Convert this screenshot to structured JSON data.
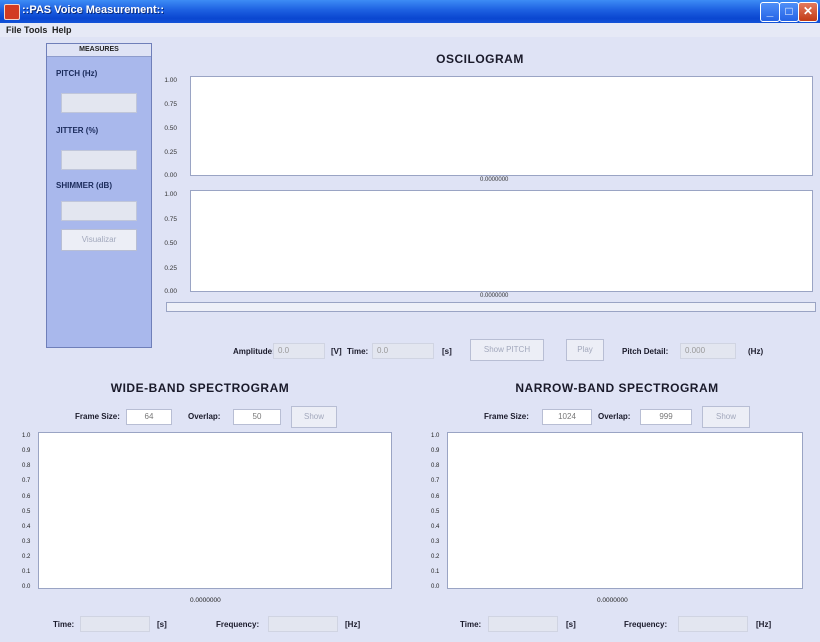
{
  "window": {
    "title": "::PAS Voice Measurement::"
  },
  "menu": [
    "File",
    "Tools",
    "Help"
  ],
  "measures": {
    "header": "MEASURES",
    "pitch_label": "PITCH (Hz)",
    "jitter_label": "JITTER (%)",
    "shimmer_label": "SHIMMER (dB)",
    "visualize_button": "Visualizar"
  },
  "oscilogram": {
    "title": "OSCILOGRAM",
    "top_ticks": [
      "1.00",
      "0.75",
      "0.50",
      "0.25",
      "0.00"
    ],
    "bottom_ticks": [
      "1.00",
      "0.75",
      "0.50",
      "0.25",
      "0.00"
    ],
    "top_x_label": "0.0000000",
    "bottom_x_label": "0.0000000",
    "amplitude_label": "Amplitude:",
    "amplitude_value": "0.0",
    "amplitude_unit": "[V]",
    "time_label": "Time:",
    "time_value": "0.0",
    "time_unit": "[s]",
    "show_pitch_button": "Show PITCH",
    "play_button": "Play",
    "pitch_detail_label": "Pitch Detail:",
    "pitch_detail_value": "0.000",
    "pitch_detail_unit": "(Hz)"
  },
  "wideband": {
    "title": "WIDE-BAND SPECTROGRAM",
    "frame_size_label": "Frame Size:",
    "frame_size_value": "64",
    "overlap_label": "Overlap:",
    "overlap_value": "50",
    "show_button": "Show",
    "y_ticks": [
      "1.0",
      "0.9",
      "0.8",
      "0.7",
      "0.6",
      "0.5",
      "0.4",
      "0.3",
      "0.2",
      "0.1",
      "0.0"
    ],
    "x_label": "0.0000000",
    "time_label": "Time:",
    "time_unit": "[s]",
    "frequency_label": "Frequency:",
    "frequency_unit": "[Hz]"
  },
  "narrowband": {
    "title": "NARROW-BAND SPECTROGRAM",
    "frame_size_label": "Frame Size:",
    "frame_size_value": "1024",
    "overlap_label": "Overlap:",
    "overlap_value": "999",
    "show_button": "Show",
    "y_ticks": [
      "1.0",
      "0.9",
      "0.8",
      "0.7",
      "0.6",
      "0.5",
      "0.4",
      "0.3",
      "0.2",
      "0.1",
      "0.0"
    ],
    "x_label": "0.0000000",
    "time_label": "Time:",
    "time_unit": "[s]",
    "frequency_label": "Frequency:",
    "frequency_unit": "[Hz]"
  }
}
